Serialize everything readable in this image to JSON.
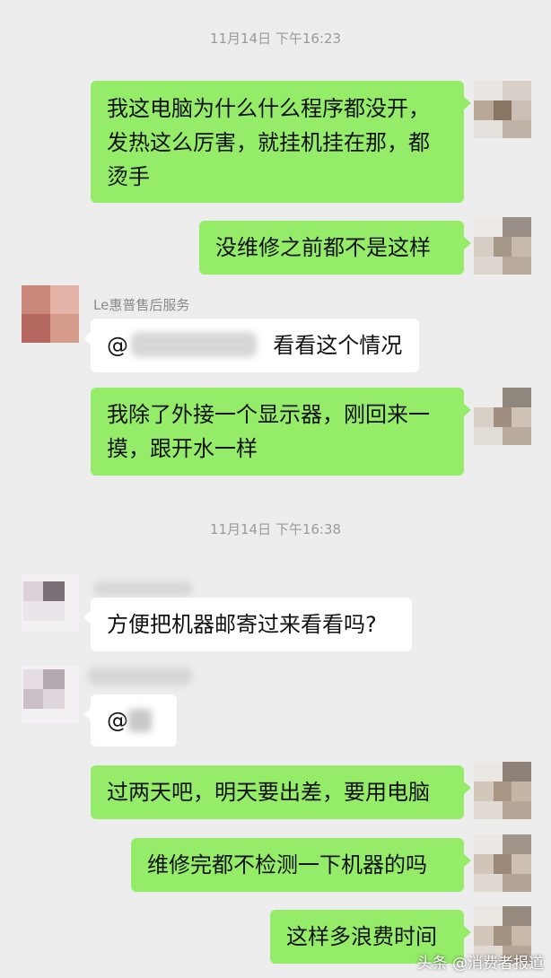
{
  "timestamps": [
    "11月14日 下午16:23",
    "11月14日 下午16:38"
  ],
  "messages": {
    "m1_line1": "我这电脑为什么什么程序都没开，",
    "m1_line2": "发热这么厉害，就挂机挂在那，都",
    "m1_line3": "烫手",
    "m2": "没维修之前都不是这样",
    "m3_sender": "Le惠普售后服务",
    "m3_mention": "@",
    "m3_text": "看看这个情况",
    "m4_line1": "我除了外接一个显示器，刚回来一",
    "m4_line2": "摸，跟开水一样",
    "m5": "方便把机器邮寄过来看看吗?",
    "m6_mention": "@",
    "m7": "过两天吧，明天要出差，要用电脑",
    "m8": "维修完都不检测一下机器的吗",
    "m9": "这样多浪费时间"
  },
  "watermark": "头条 @消费者报道",
  "colors": {
    "bubble_self": "#95ec69",
    "bubble_other": "#ffffff",
    "background": "#ededed"
  }
}
